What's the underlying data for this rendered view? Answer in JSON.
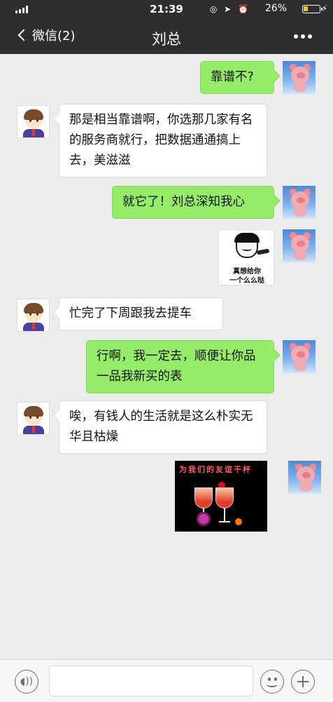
{
  "status_bar": {
    "time": "21:39",
    "battery_percent": "26%",
    "battery_level": 0.26
  },
  "header": {
    "back_label": "微信(2)",
    "title": "刘总"
  },
  "messages": [
    {
      "side": "out",
      "text": "靠谱不?"
    },
    {
      "side": "in",
      "text": "那是相当靠谱啊，你选那几家有名的服务商就行，把数据通通搞上去，美滋滋"
    },
    {
      "side": "out",
      "text": "就它了！刘总深知我心"
    },
    {
      "side": "out",
      "type": "sticker",
      "sticker_text": [
        "真想给你",
        "一个么么哒"
      ]
    },
    {
      "side": "in",
      "text": "忙完了下周跟我去提车"
    },
    {
      "side": "out",
      "text": "行啊，我一定去，顺便让你品一品我新买的表"
    },
    {
      "side": "in",
      "text": "唉，有钱人的生活就是这么朴实无华且枯燥"
    },
    {
      "side": "out",
      "type": "sticker",
      "sticker_text": [
        "为我们的友谊干杯"
      ]
    }
  ],
  "input_bar": {
    "value": ""
  },
  "colors": {
    "outgoing_bubble": "#95ec69",
    "incoming_bubble": "#ffffff",
    "chat_background": "#ececec",
    "header": "#2e2e2e"
  }
}
